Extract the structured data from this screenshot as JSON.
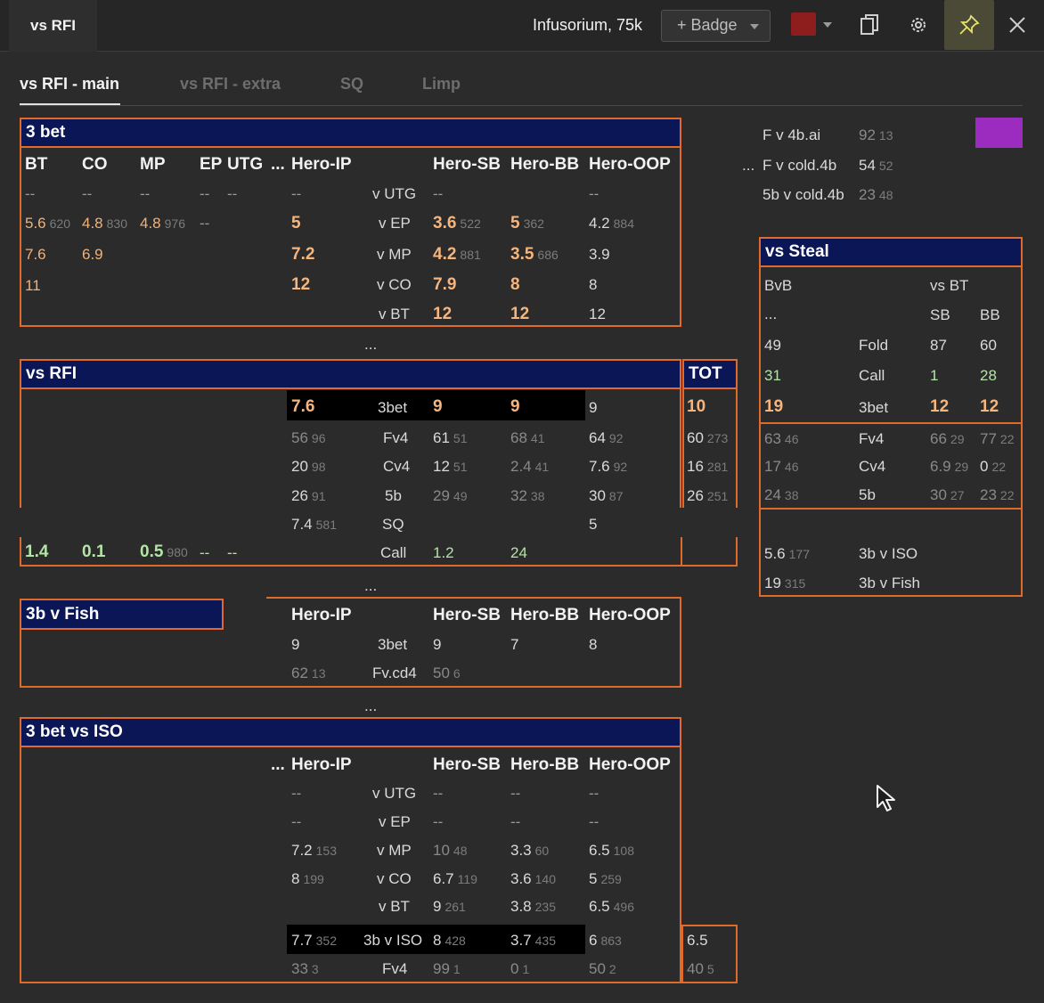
{
  "window": {
    "title": "vs RFI",
    "user": "Infusorium, 75k",
    "badge_label": "+ Badge"
  },
  "colors": {
    "accent_border": "#e06a2a",
    "header_bg": "#0b1657",
    "swatch": "#8e1e1e",
    "purple_swatch": "#9c2cc0"
  },
  "toolbar_icons": [
    "copy-icon",
    "gear-icon",
    "pin-icon",
    "close-icon"
  ],
  "tabs": [
    "vs RFI - main",
    "vs RFI - extra",
    "SQ",
    "Limp"
  ],
  "three_bet": {
    "title": "3 bet",
    "cols": [
      "BT",
      "CO",
      "MP",
      "EP",
      "UTG",
      "...",
      "Hero-IP",
      "Hero-SB",
      "Hero-BB",
      "Hero-OOP"
    ],
    "rows_labels": [
      "v UTG",
      "v EP",
      "v MP",
      "v CO",
      "v BT"
    ],
    "pos": {
      "r0": [
        "--",
        "--",
        "--",
        "--",
        "--"
      ],
      "r1": [
        [
          "5.6",
          "620"
        ],
        [
          "4.8",
          "830"
        ],
        [
          "4.8",
          "976"
        ],
        "--"
      ],
      "r2": [
        "7.6",
        "6.9"
      ],
      "r3": [
        "11"
      ]
    },
    "hero": {
      "ip": [
        "--",
        "5",
        "7.2",
        "12",
        ""
      ],
      "sb": [
        "--",
        [
          "3.6",
          "522"
        ],
        [
          "4.2",
          "881"
        ],
        "7.9",
        "12"
      ],
      "bb": [
        "",
        [
          "5",
          "362"
        ],
        [
          "3.5",
          "686"
        ],
        "8",
        "12"
      ],
      "oop": [
        "--",
        [
          "4.2",
          "884"
        ],
        "3.9",
        "8",
        "12"
      ]
    },
    "dots": "...",
    "side_dots": "..."
  },
  "side": {
    "fv4b_label": "F v 4b.ai",
    "fv4b_val": "92",
    "fv4b_n": "13",
    "fcold_label": "F v cold.4b",
    "fcold_val": "54",
    "fcold_n": "52",
    "fivebet_label": "5b v cold.4b",
    "fivebet_val": "23",
    "fivebet_n": "48"
  },
  "vs_rfi": {
    "title": "vs RFI",
    "tot": "TOT",
    "labels": [
      "3bet",
      "Fv4",
      "Cv4",
      "5b",
      "SQ",
      "Call"
    ],
    "ip": [
      "7.6",
      [
        "56",
        "96"
      ],
      [
        "20",
        "98"
      ],
      [
        "26",
        "91"
      ],
      [
        "7.4",
        "581"
      ],
      ""
    ],
    "sb": [
      "9",
      [
        "61",
        "51"
      ],
      [
        "12",
        "51"
      ],
      [
        "29",
        "49"
      ],
      "",
      "1.2"
    ],
    "bb": [
      "9",
      [
        "68",
        "41"
      ],
      [
        "2.4",
        "41"
      ],
      [
        "32",
        "38"
      ],
      "",
      "24"
    ],
    "oop": [
      "9",
      [
        "64",
        "92"
      ],
      [
        "7.6",
        "92"
      ],
      [
        "30",
        "87"
      ],
      "5",
      ""
    ],
    "tot_vals": [
      "10",
      [
        "60",
        "273"
      ],
      [
        "16",
        "281"
      ],
      [
        "26",
        "251"
      ],
      "",
      ""
    ],
    "call_pos": [
      "1.4",
      "0.1",
      [
        "0.5",
        "980"
      ],
      "--",
      "--"
    ],
    "dots": "..."
  },
  "fish": {
    "title": "3b v Fish",
    "cols": [
      "Hero-IP",
      "Hero-SB",
      "Hero-BB",
      "Hero-OOP"
    ],
    "labels": [
      "3bet",
      "Fv.cd4"
    ],
    "ip": [
      "9",
      [
        "62",
        "13"
      ]
    ],
    "sb": [
      "9",
      [
        "50",
        "6"
      ]
    ],
    "bb": [
      "7",
      ""
    ],
    "oop": [
      "8",
      ""
    ],
    "dots": "..."
  },
  "iso": {
    "title": "3 bet vs ISO",
    "cols": [
      "...",
      "Hero-IP",
      "Hero-SB",
      "Hero-BB",
      "Hero-OOP"
    ],
    "labels": [
      "v UTG",
      "v EP",
      "v MP",
      "v CO",
      "v BT",
      "3b v ISO",
      "Fv4"
    ],
    "ip": [
      "--",
      "--",
      [
        "7.2",
        "153"
      ],
      [
        "8",
        "199"
      ],
      "",
      [
        "7.7",
        "352"
      ],
      [
        "33",
        "3"
      ]
    ],
    "sb": [
      "--",
      "--",
      [
        "10",
        "48"
      ],
      [
        "6.7",
        "119"
      ],
      [
        "9",
        "261"
      ],
      [
        "8",
        "428"
      ],
      [
        "99",
        "1"
      ]
    ],
    "bb": [
      "--",
      "--",
      [
        "3.3",
        "60"
      ],
      [
        "3.6",
        "140"
      ],
      [
        "3.8",
        "235"
      ],
      [
        "3.7",
        "435"
      ],
      [
        "0",
        "1"
      ]
    ],
    "oop": [
      "--",
      "--",
      [
        "6.5",
        "108"
      ],
      [
        "5",
        "259"
      ],
      [
        "6.5",
        "496"
      ],
      [
        "6",
        "863"
      ],
      [
        "50",
        "2"
      ]
    ],
    "tot": [
      "6.5",
      [
        "40",
        "5"
      ]
    ]
  },
  "steal": {
    "title": "vs Steal",
    "bvb": "BvB",
    "vsbt": "vs BT",
    "sb": "SB",
    "bb": "BB",
    "dots": "...",
    "rows": [
      {
        "bvb": "49",
        "label": "Fold",
        "sb": "87",
        "bb": "60"
      },
      {
        "bvb": "31",
        "label": "Call",
        "sb": "1",
        "bb": "28"
      },
      {
        "bvb": "19",
        "label": "3bet",
        "sb": "12",
        "bb": "12"
      },
      {
        "bvb": [
          "63",
          "46"
        ],
        "label": "Fv4",
        "sb": [
          "66",
          "29"
        ],
        "bb": [
          "77",
          "22"
        ]
      },
      {
        "bvb": [
          "17",
          "46"
        ],
        "label": "Cv4",
        "sb": [
          "6.9",
          "29"
        ],
        "bb": [
          "0",
          "22"
        ]
      },
      {
        "bvb": [
          "24",
          "38"
        ],
        "label": "5b",
        "sb": [
          "30",
          "27"
        ],
        "bb": [
          "23",
          "22"
        ]
      }
    ],
    "iso_val": "5.6",
    "iso_n": "177",
    "iso_label": "3b v ISO",
    "fish_val": "19",
    "fish_n": "315",
    "fish_label": "3b v Fish"
  }
}
